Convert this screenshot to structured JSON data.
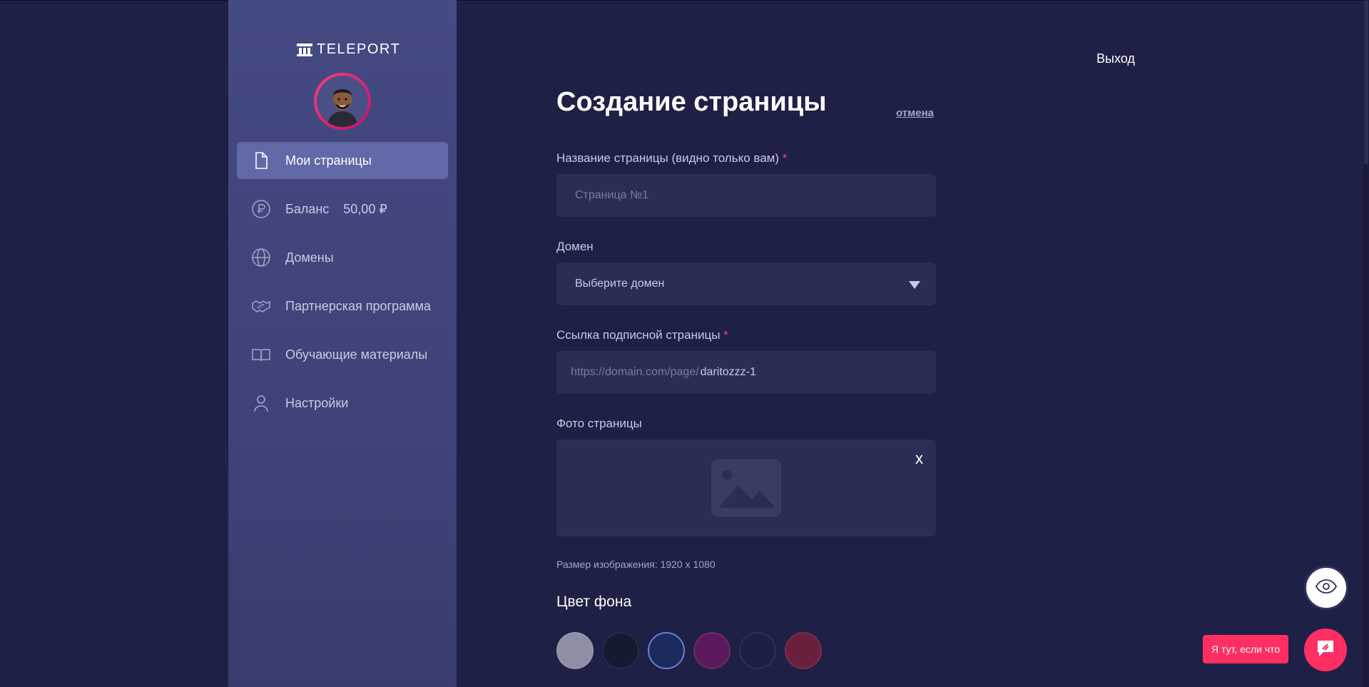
{
  "brand": {
    "name": "TELEPORT"
  },
  "sidebar": {
    "items": [
      {
        "label": "Мои страницы",
        "icon": "file-icon"
      },
      {
        "label": "Баланс",
        "value": "50,00 ₽",
        "icon": "ruble-icon"
      },
      {
        "label": "Домены",
        "icon": "globe-icon"
      },
      {
        "label": "Партнерская программа",
        "icon": "handshake-icon"
      },
      {
        "label": "Обучающие материалы",
        "icon": "book-icon"
      },
      {
        "label": "Настройки",
        "icon": "user-icon"
      }
    ],
    "active_index": 0
  },
  "header": {
    "logout": "Выход"
  },
  "form": {
    "title": "Создание страницы",
    "cancel": "отмена",
    "page_name": {
      "label": "Название страницы (видно только вам)",
      "required_mark": "*",
      "placeholder": "Страница №1",
      "value": ""
    },
    "domain": {
      "label": "Домен",
      "selected": "Выберите домен"
    },
    "link": {
      "label": "Ссылка подписной страницы",
      "required_mark": "*",
      "prefix": "https://domain.com/page/",
      "value": "daritozzz-1"
    },
    "photo": {
      "label": "Фото страницы",
      "close": "x"
    },
    "image_hint": "Размер изображения: 1920 x 1080",
    "bg_color": {
      "title": "Цвет фона",
      "swatches": [
        "#8e8fa4",
        "#151a33",
        "#1c2a5e",
        "#5c1a5e",
        "#1d2045",
        "#6a1f3f"
      ],
      "selected_index": 2
    }
  },
  "widgets": {
    "help_text": "Я тут, если что"
  },
  "colors": {
    "accent": "#ff2f63",
    "sidebar_active": "#6269a8",
    "background": "#1f2046"
  }
}
